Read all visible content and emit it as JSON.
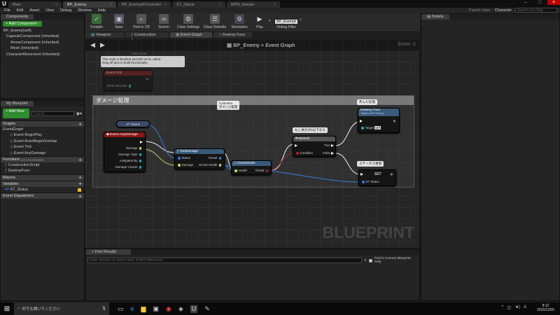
{
  "title_tabs": [
    {
      "label": "Main"
    },
    {
      "label": "BP_Enemy",
      "active": true
    },
    {
      "label": "BP_EnemyAIController"
    },
    {
      "label": "ST_Status"
    },
    {
      "label": "BPM_Statuler"
    }
  ],
  "menu": [
    "File",
    "Edit",
    "Asset",
    "View",
    "Debug",
    "Window",
    "Help"
  ],
  "parent_class": {
    "label": "Parent class:",
    "value": "Character"
  },
  "help_search": "Search For Help",
  "components": {
    "tab": "Components",
    "add_label": "+ Add Component -",
    "items": [
      "BP_Enemy(self)",
      "CapsuleComponent (Inherited)",
      "ArrowComponent (Inherited)",
      "Mesh (Inherited)",
      "CharacterMovement (Inherited)"
    ]
  },
  "my_blueprint": {
    "tab": "My Blueprint",
    "add_label": "+ Add New -",
    "search_placeholder": "Search",
    "graphs_header": "Graphs",
    "event_graph": "EventGraph",
    "events": [
      "Event BeginPlay",
      "Event ActorBeginOverlap",
      "Event Tick",
      "Event AnyDamage"
    ],
    "functions_header": "Functions",
    "functions_note": "(26 Overridable)",
    "functions": [
      "ConstructionScript",
      "DestroyFunc"
    ],
    "macros_header": "Macros",
    "variables_header": "Variables",
    "variables": [
      "ST_Status"
    ],
    "dispatchers_header": "Event Dispatchers"
  },
  "toolbar": [
    {
      "label": "Compile",
      "icon": "compile-icon"
    },
    {
      "label": "Save",
      "icon": "save-icon"
    },
    {
      "label": "Find in CB",
      "icon": "find-icon"
    },
    {
      "label": "Search",
      "icon": "binoculars-icon"
    },
    {
      "label": "Class Settings",
      "icon": "gear-icon"
    },
    {
      "label": "Class Defaults",
      "icon": "defaults-icon"
    },
    {
      "label": "Simulation",
      "icon": "simulate-icon"
    },
    {
      "label": "Play",
      "icon": "play-icon"
    }
  ],
  "debug_filter": {
    "value": "BP_Enemy▾",
    "label": "Debug Filter"
  },
  "editor_tabs": [
    "Viewport",
    "Construction Script",
    "Event Graph",
    "Destroy Func"
  ],
  "breadcrumb": {
    "bp": "BP_Enemy",
    "sep": ">",
    "graph": "Event Graph"
  },
  "zoom": "Zoom -1",
  "watermark": "BLUEPRINT",
  "details_tab": "Details",
  "find_results": {
    "tab": "Find Results",
    "placeholder": "Enter function or event name to find references...",
    "checkbox_label": "Find in Current Blueprint Only"
  },
  "graph": {
    "comment_title": "ダメージ処理",
    "disabled_node": {
      "title": "Event Tick",
      "pin": "Delta Seconds",
      "tooltip_top": "Allow Actor",
      "tooltip": "This node is disabled and will not be called.\nDrag off pins to build functionality."
    },
    "comment_bubble": "Comment\nダメージ処理",
    "st_status": "ST Status",
    "any_damage": {
      "title": "Event AnyDamage",
      "pins": [
        "Damage",
        "Damage Type",
        "Instigated By",
        "Damage Causer"
      ]
    },
    "get_damage": {
      "title": "GetDamage",
      "in": [
        "Status",
        "Damage"
      ],
      "out": [
        "Result",
        "Result Health"
      ]
    },
    "check_death": {
      "title": "CheckDeath",
      "in": "Health",
      "out": "Result"
    },
    "branch": {
      "title": "Branch",
      "bubble": "もし体力が0以下なら",
      "condition": "Condition",
      "true": "True",
      "false": "False"
    },
    "destroy": {
      "bubble": "死んだ処理",
      "title": "Destroy Func",
      "subtitle": "Target is BP Enemy",
      "target": "Target",
      "self": "self"
    },
    "set_node": {
      "bubble": "ステータス更新",
      "title": "SET",
      "pin": "ST Status"
    }
  },
  "taskbar": {
    "search": "何でも聞いてください",
    "time": "8:12",
    "date": "2016/12/05"
  }
}
